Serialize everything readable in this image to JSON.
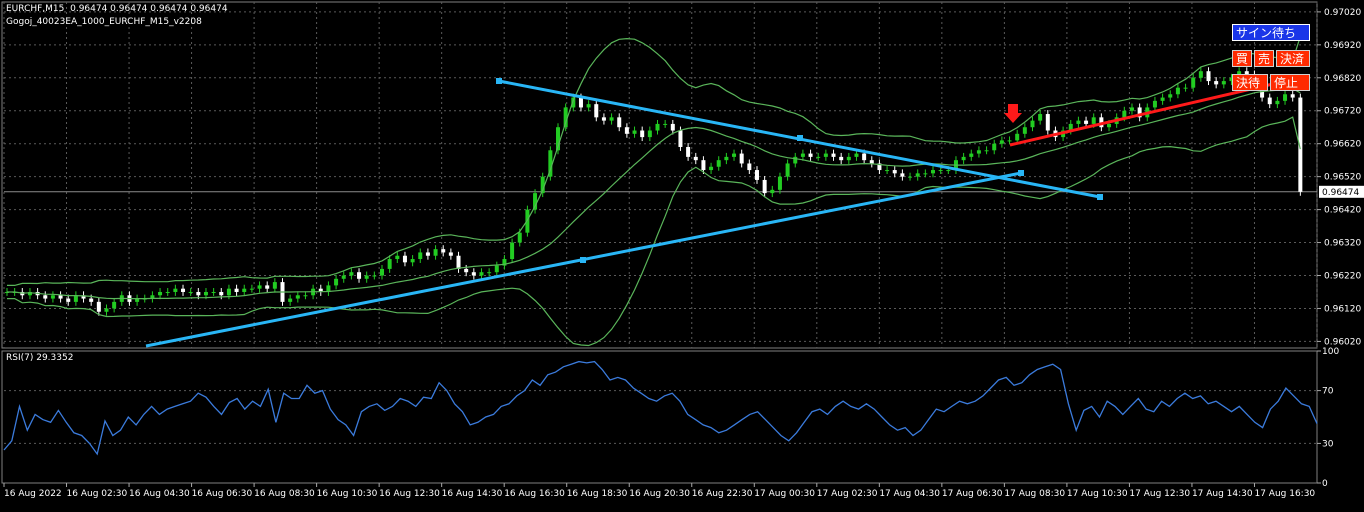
{
  "window": {
    "symbol_line": "EURCHF,M15  0.96474 0.96474 0.96474 0.96474",
    "ea_name": "Gogoj_40023EA_1000_EURCHF_M15_v2208",
    "rsi_label": "RSI(7) 29.3352"
  },
  "buttons": {
    "sign_wait": "サイン待ち",
    "buy": "買",
    "sell": "売",
    "settle": "決済",
    "settle_wait": "決待",
    "stop": "停止"
  },
  "colors": {
    "background": "#000000",
    "grid": "#5a5a5a",
    "bull_candle": "#22cc22",
    "bear_candle": "#ffffff",
    "bollinger": "#5ab55a",
    "trendline": "#29b6f6",
    "signal_line": "#ff1a1a",
    "arrow": "#ff1a1a",
    "rsi_line": "#3b7bdc",
    "axis_text": "#ffffff"
  },
  "chart_data": [
    {
      "type": "candlestick",
      "title": "EURCHF,M15",
      "ylim": [
        0.96,
        0.9705
      ],
      "y_ticks": [
        "0.97020",
        "0.96920",
        "0.96820",
        "0.96720",
        "0.96620",
        "0.96520",
        "0.96420",
        "0.96320",
        "0.96220",
        "0.96120",
        "0.96020"
      ],
      "price_marker": "0.96474",
      "x_tick_labels": [
        "16 Aug 2022",
        "16 Aug 02:30",
        "16 Aug 04:30",
        "16 Aug 06:30",
        "16 Aug 08:30",
        "16 Aug 10:30",
        "16 Aug 12:30",
        "16 Aug 14:30",
        "16 Aug 16:30",
        "16 Aug 18:30",
        "16 Aug 20:30",
        "16 Aug 22:30",
        "17 Aug 00:30",
        "17 Aug 02:30",
        "17 Aug 04:30",
        "17 Aug 06:30",
        "17 Aug 08:30",
        "17 Aug 10:30",
        "17 Aug 12:30",
        "17 Aug 14:30",
        "17 Aug 16:30"
      ],
      "close": [
        0.9617,
        0.9617,
        0.9616,
        0.9617,
        0.9616,
        0.9615,
        0.9616,
        0.9615,
        0.9614,
        0.9616,
        0.9615,
        0.9614,
        0.9611,
        0.9612,
        0.9614,
        0.9616,
        0.9614,
        0.9615,
        0.9615,
        0.9616,
        0.9617,
        0.9617,
        0.9618,
        0.9617,
        0.9617,
        0.9616,
        0.9617,
        0.9617,
        0.9616,
        0.9618,
        0.9617,
        0.9618,
        0.9618,
        0.9619,
        0.9618,
        0.962,
        0.9614,
        0.9615,
        0.9616,
        0.9616,
        0.9618,
        0.9617,
        0.9619,
        0.9621,
        0.9622,
        0.9623,
        0.9621,
        0.9622,
        0.9622,
        0.9624,
        0.9627,
        0.9628,
        0.9626,
        0.9627,
        0.9629,
        0.9628,
        0.963,
        0.9629,
        0.9628,
        0.9624,
        0.9623,
        0.9622,
        0.9623,
        0.9623,
        0.9625,
        0.9627,
        0.9632,
        0.9635,
        0.9642,
        0.9647,
        0.9652,
        0.966,
        0.9667,
        0.9673,
        0.9676,
        0.9673,
        0.9674,
        0.967,
        0.9669,
        0.967,
        0.9667,
        0.9665,
        0.9666,
        0.9664,
        0.9666,
        0.9668,
        0.9668,
        0.9666,
        0.9661,
        0.9658,
        0.9657,
        0.9654,
        0.9655,
        0.9657,
        0.9658,
        0.9659,
        0.9656,
        0.9654,
        0.9651,
        0.9647,
        0.9648,
        0.9652,
        0.9656,
        0.9658,
        0.9659,
        0.9658,
        0.9658,
        0.9659,
        0.9658,
        0.9657,
        0.9658,
        0.9659,
        0.9657,
        0.9656,
        0.9654,
        0.9654,
        0.9653,
        0.9652,
        0.9652,
        0.9653,
        0.9653,
        0.9654,
        0.9654,
        0.9654,
        0.9657,
        0.9658,
        0.9659,
        0.966,
        0.966,
        0.9662,
        0.9663,
        0.9663,
        0.9665,
        0.9667,
        0.9669,
        0.9671,
        0.9666,
        0.9664,
        0.9666,
        0.9668,
        0.9669,
        0.9668,
        0.967,
        0.9667,
        0.9668,
        0.967,
        0.9672,
        0.9673,
        0.967,
        0.9673,
        0.9675,
        0.9676,
        0.9677,
        0.9679,
        0.9679,
        0.9682,
        0.9684,
        0.9681,
        0.968,
        0.9681,
        0.9682,
        0.9684,
        0.9683,
        0.968,
        0.9676,
        0.9674,
        0.9675,
        0.9677,
        0.9676,
        0.96474
      ]
    },
    {
      "type": "line",
      "title": "RSI(7) 29.3352",
      "ylim": [
        0,
        100
      ],
      "y_ticks": [
        "100",
        "70",
        "30",
        "0"
      ],
      "values": [
        25,
        32,
        58,
        40,
        52,
        48,
        46,
        55,
        46,
        38,
        36,
        30,
        22,
        47,
        36,
        40,
        50,
        44,
        52,
        58,
        52,
        56,
        58,
        60,
        62,
        68,
        65,
        58,
        52,
        61,
        64,
        56,
        62,
        58,
        71,
        46,
        68,
        64,
        64,
        74,
        68,
        70,
        56,
        48,
        44,
        36,
        54,
        58,
        60,
        55,
        58,
        64,
        62,
        58,
        65,
        64,
        76,
        70,
        60,
        54,
        44,
        46,
        50,
        52,
        58,
        60,
        66,
        70,
        78,
        74,
        82,
        84,
        88,
        90,
        92,
        91,
        92,
        86,
        78,
        80,
        78,
        72,
        68,
        64,
        62,
        66,
        68,
        62,
        52,
        48,
        44,
        42,
        38,
        40,
        44,
        48,
        52,
        54,
        48,
        42,
        36,
        32,
        38,
        46,
        54,
        56,
        52,
        58,
        62,
        58,
        56,
        60,
        56,
        50,
        44,
        40,
        42,
        36,
        40,
        48,
        56,
        54,
        58,
        62,
        60,
        62,
        66,
        72,
        78,
        80,
        74,
        76,
        82,
        86,
        88,
        90,
        86,
        60,
        40,
        55,
        58,
        50,
        62,
        58,
        52,
        58,
        64,
        56,
        54,
        62,
        58,
        64,
        68,
        64,
        66,
        60,
        62,
        58,
        54,
        58,
        52,
        46,
        42,
        56,
        62,
        72,
        66,
        60,
        58,
        45
      ]
    }
  ]
}
